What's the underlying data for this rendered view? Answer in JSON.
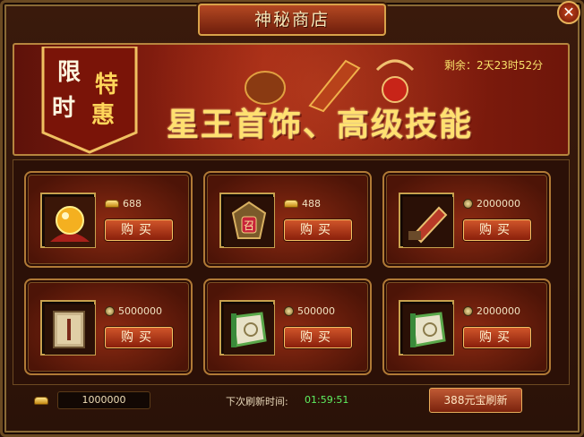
{
  "window": {
    "title": "神秘商店"
  },
  "banner": {
    "badge_chars": [
      "限",
      "特",
      "时",
      "惠"
    ],
    "headline": "星王首饰、高级技能",
    "timer": "剩余：2天23时52分"
  },
  "items": [
    {
      "price": "688",
      "currency": "ingot",
      "buy_label": "购买",
      "icon": "golden-orb-icon"
    },
    {
      "price": "488",
      "currency": "ingot",
      "buy_label": "购买",
      "icon": "helmet-medal-icon"
    },
    {
      "price": "2000000",
      "currency": "coin",
      "buy_label": "购买",
      "icon": "scroll-red-icon"
    },
    {
      "price": "5000000",
      "currency": "coin",
      "buy_label": "购买",
      "icon": "book-icon"
    },
    {
      "price": "500000",
      "currency": "coin",
      "buy_label": "购买",
      "icon": "green-scroll-icon"
    },
    {
      "price": "2000000",
      "currency": "coin",
      "buy_label": "购买",
      "icon": "green-scroll-icon"
    }
  ],
  "footer": {
    "gold": "1000000",
    "next_refresh_label": "下次刷新时间:",
    "next_refresh_time": "01:59:51",
    "refresh_button": "388元宝刷新"
  },
  "colors": {
    "accent": "#b6853e",
    "buy": "#8a1f0b",
    "timer": "#5ef060"
  }
}
